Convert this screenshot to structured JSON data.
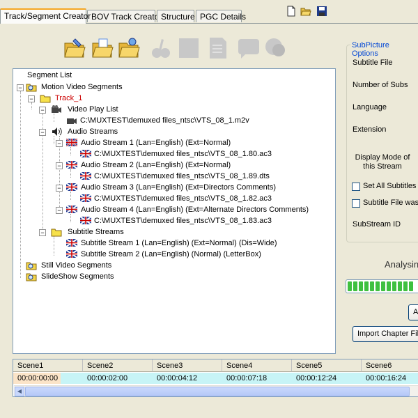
{
  "tabs": [
    {
      "label": "Track/Segment Creator",
      "active": true
    },
    {
      "label": "BOV Track Creator",
      "active": false
    },
    {
      "label": "Structure",
      "active": false
    },
    {
      "label": "PGC Details",
      "active": false
    }
  ],
  "file_toolbar": [
    "new-file-icon",
    "open-folder-icon",
    "save-disk-icon"
  ],
  "toolbar_icons": [
    "open-folder-edit-icon",
    "open-folder-doc-icon",
    "open-folder-add-icon",
    "audio-icon-disabled",
    "stop-icon-disabled",
    "document-icon-disabled",
    "subtitle-icon-disabled",
    "chapter-icon-disabled"
  ],
  "tree": {
    "title": "Segment List",
    "nodes": [
      {
        "label": "Motion Video Segments"
      },
      {
        "label": "Track_1"
      },
      {
        "label": "Video Play List"
      },
      {
        "label": "C:\\MUXTEST\\demuxed files_ntsc\\VTS_08_1.m2v"
      },
      {
        "label": "Audio Streams"
      },
      {
        "label": "Audio Stream 1 (Lan=English) (Ext=Normal)"
      },
      {
        "label": "C:\\MUXTEST\\demuxed files_ntsc\\VTS_08_1.80.ac3"
      },
      {
        "label": "Audio Stream 2 (Lan=English) (Ext=Normal)"
      },
      {
        "label": "C:\\MUXTEST\\demuxed files_ntsc\\VTS_08_1.89.dts"
      },
      {
        "label": "Audio Stream 3 (Lan=English) (Ext=Directors Comments)"
      },
      {
        "label": "C:\\MUXTEST\\demuxed files_ntsc\\VTS_08_1.82.ac3"
      },
      {
        "label": "Audio Stream 4 (Lan=English) (Ext=Alternate Directors Comments)"
      },
      {
        "label": "C:\\MUXTEST\\demuxed files_ntsc\\VTS_08_1.83.ac3"
      },
      {
        "label": "Subtitle Streams"
      },
      {
        "label": "Subtitle Stream 1 (Lan=English) (Ext=Normal) (Dis=Wide)"
      },
      {
        "label": "Subtitle Stream 2 (Lan=English) (Normal) (LetterBox)"
      },
      {
        "label": "Still Video Segments"
      },
      {
        "label": "SlideShow Segments"
      }
    ]
  },
  "subpicture": {
    "title": "SubPicture Options",
    "subtitle_file": "Subtitle File",
    "number_of_subs": "Number of Subs",
    "language": "Language",
    "extension": "Extension",
    "display_mode": "Display Mode of this Stream",
    "set_all": "Set All Subtitles i",
    "subtitle_file_was": "Subtitle File was",
    "substream_id": "SubStream ID"
  },
  "status": {
    "analysing": "Analysin",
    "progress": 0.95
  },
  "buttons": {
    "a": "A",
    "import_chapter": "Import Chapter File"
  },
  "scenes": {
    "headers": [
      "Scene1",
      "Scene2",
      "Scene3",
      "Scene4",
      "Scene5",
      "Scene6"
    ],
    "values": [
      "00:00:00:00",
      "00:00:02:00",
      "00:00:04:12",
      "00:00:07:18",
      "00:00:12:24",
      "00:00:16:24"
    ]
  },
  "colors": {
    "accent": "#f5a623",
    "group_title": "#0046d5",
    "track_label": "#cc0000",
    "progress": "#3fc040"
  }
}
